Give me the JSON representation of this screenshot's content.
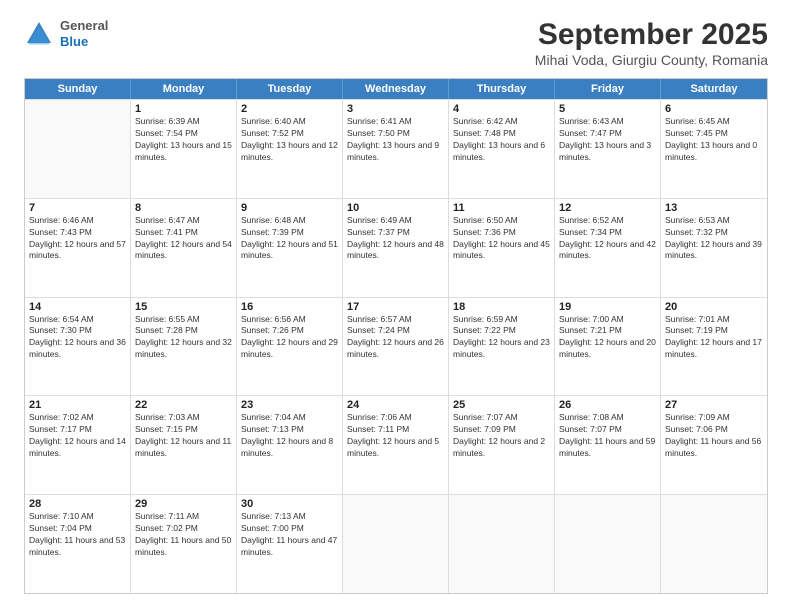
{
  "header": {
    "logo": {
      "general": "General",
      "blue": "Blue"
    },
    "title": "September 2025",
    "subtitle": "Mihai Voda, Giurgiu County, Romania"
  },
  "weekdays": [
    "Sunday",
    "Monday",
    "Tuesday",
    "Wednesday",
    "Thursday",
    "Friday",
    "Saturday"
  ],
  "weeks": [
    [
      {
        "day": null
      },
      {
        "day": "1",
        "sunrise": "6:39 AM",
        "sunset": "7:54 PM",
        "daylight": "13 hours and 15 minutes."
      },
      {
        "day": "2",
        "sunrise": "6:40 AM",
        "sunset": "7:52 PM",
        "daylight": "13 hours and 12 minutes."
      },
      {
        "day": "3",
        "sunrise": "6:41 AM",
        "sunset": "7:50 PM",
        "daylight": "13 hours and 9 minutes."
      },
      {
        "day": "4",
        "sunrise": "6:42 AM",
        "sunset": "7:48 PM",
        "daylight": "13 hours and 6 minutes."
      },
      {
        "day": "5",
        "sunrise": "6:43 AM",
        "sunset": "7:47 PM",
        "daylight": "13 hours and 3 minutes."
      },
      {
        "day": "6",
        "sunrise": "6:45 AM",
        "sunset": "7:45 PM",
        "daylight": "13 hours and 0 minutes."
      }
    ],
    [
      {
        "day": "7",
        "sunrise": "6:46 AM",
        "sunset": "7:43 PM",
        "daylight": "12 hours and 57 minutes."
      },
      {
        "day": "8",
        "sunrise": "6:47 AM",
        "sunset": "7:41 PM",
        "daylight": "12 hours and 54 minutes."
      },
      {
        "day": "9",
        "sunrise": "6:48 AM",
        "sunset": "7:39 PM",
        "daylight": "12 hours and 51 minutes."
      },
      {
        "day": "10",
        "sunrise": "6:49 AM",
        "sunset": "7:37 PM",
        "daylight": "12 hours and 48 minutes."
      },
      {
        "day": "11",
        "sunrise": "6:50 AM",
        "sunset": "7:36 PM",
        "daylight": "12 hours and 45 minutes."
      },
      {
        "day": "12",
        "sunrise": "6:52 AM",
        "sunset": "7:34 PM",
        "daylight": "12 hours and 42 minutes."
      },
      {
        "day": "13",
        "sunrise": "6:53 AM",
        "sunset": "7:32 PM",
        "daylight": "12 hours and 39 minutes."
      }
    ],
    [
      {
        "day": "14",
        "sunrise": "6:54 AM",
        "sunset": "7:30 PM",
        "daylight": "12 hours and 36 minutes."
      },
      {
        "day": "15",
        "sunrise": "6:55 AM",
        "sunset": "7:28 PM",
        "daylight": "12 hours and 32 minutes."
      },
      {
        "day": "16",
        "sunrise": "6:56 AM",
        "sunset": "7:26 PM",
        "daylight": "12 hours and 29 minutes."
      },
      {
        "day": "17",
        "sunrise": "6:57 AM",
        "sunset": "7:24 PM",
        "daylight": "12 hours and 26 minutes."
      },
      {
        "day": "18",
        "sunrise": "6:59 AM",
        "sunset": "7:22 PM",
        "daylight": "12 hours and 23 minutes."
      },
      {
        "day": "19",
        "sunrise": "7:00 AM",
        "sunset": "7:21 PM",
        "daylight": "12 hours and 20 minutes."
      },
      {
        "day": "20",
        "sunrise": "7:01 AM",
        "sunset": "7:19 PM",
        "daylight": "12 hours and 17 minutes."
      }
    ],
    [
      {
        "day": "21",
        "sunrise": "7:02 AM",
        "sunset": "7:17 PM",
        "daylight": "12 hours and 14 minutes."
      },
      {
        "day": "22",
        "sunrise": "7:03 AM",
        "sunset": "7:15 PM",
        "daylight": "12 hours and 11 minutes."
      },
      {
        "day": "23",
        "sunrise": "7:04 AM",
        "sunset": "7:13 PM",
        "daylight": "12 hours and 8 minutes."
      },
      {
        "day": "24",
        "sunrise": "7:06 AM",
        "sunset": "7:11 PM",
        "daylight": "12 hours and 5 minutes."
      },
      {
        "day": "25",
        "sunrise": "7:07 AM",
        "sunset": "7:09 PM",
        "daylight": "12 hours and 2 minutes."
      },
      {
        "day": "26",
        "sunrise": "7:08 AM",
        "sunset": "7:07 PM",
        "daylight": "11 hours and 59 minutes."
      },
      {
        "day": "27",
        "sunrise": "7:09 AM",
        "sunset": "7:06 PM",
        "daylight": "11 hours and 56 minutes."
      }
    ],
    [
      {
        "day": "28",
        "sunrise": "7:10 AM",
        "sunset": "7:04 PM",
        "daylight": "11 hours and 53 minutes."
      },
      {
        "day": "29",
        "sunrise": "7:11 AM",
        "sunset": "7:02 PM",
        "daylight": "11 hours and 50 minutes."
      },
      {
        "day": "30",
        "sunrise": "7:13 AM",
        "sunset": "7:00 PM",
        "daylight": "11 hours and 47 minutes."
      },
      {
        "day": null
      },
      {
        "day": null
      },
      {
        "day": null
      },
      {
        "day": null
      }
    ]
  ]
}
